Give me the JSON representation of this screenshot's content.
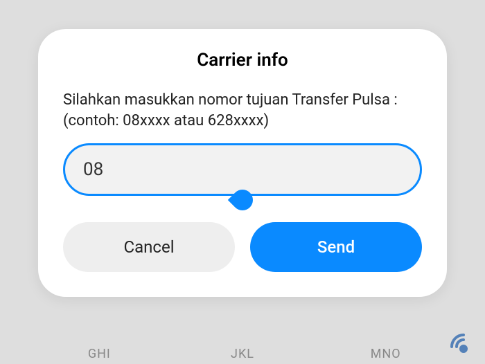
{
  "dialog": {
    "title": "Carrier info",
    "description": "Silahkan masukkan nomor tujuan Transfer Pulsa : (contoh: 08xxxx atau 628xxxx)",
    "input_value": "08",
    "cancel_label": "Cancel",
    "send_label": "Send"
  },
  "keyboard": {
    "k1": "GHI",
    "k2": "JKL",
    "k3": "MNO"
  },
  "colors": {
    "accent": "#0a8aff"
  }
}
